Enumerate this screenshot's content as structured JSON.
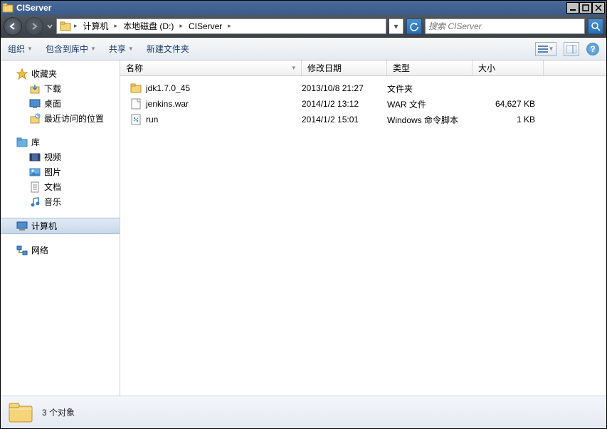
{
  "window": {
    "title": "CIServer"
  },
  "breadcrumb": {
    "seg0": "计算机",
    "seg1": "本地磁盘 (D:)",
    "seg2": "CIServer"
  },
  "search": {
    "placeholder": "搜索 CIServer"
  },
  "toolbar": {
    "organize": "组织",
    "include": "包含到库中",
    "share": "共享",
    "newfolder": "新建文件夹"
  },
  "columns": {
    "name": "名称",
    "date": "修改日期",
    "type": "类型",
    "size": "大小"
  },
  "sidebar": {
    "favorites": "收藏夹",
    "downloads": "下载",
    "desktop": "桌面",
    "recent": "最近访问的位置",
    "libraries": "库",
    "videos": "视频",
    "pictures": "图片",
    "documents": "文档",
    "music": "音乐",
    "computer": "计算机",
    "network": "网络"
  },
  "files": [
    {
      "name": "jdk1.7.0_45",
      "date": "2013/10/8 21:27",
      "type": "文件夹",
      "size": "",
      "icon": "folder"
    },
    {
      "name": "jenkins.war",
      "date": "2014/1/2 13:12",
      "type": "WAR 文件",
      "size": "64,627 KB",
      "icon": "file"
    },
    {
      "name": "run",
      "date": "2014/1/2 15:01",
      "type": "Windows 命令脚本",
      "size": "1 KB",
      "icon": "script"
    }
  ],
  "status": {
    "text": "3 个对象"
  }
}
